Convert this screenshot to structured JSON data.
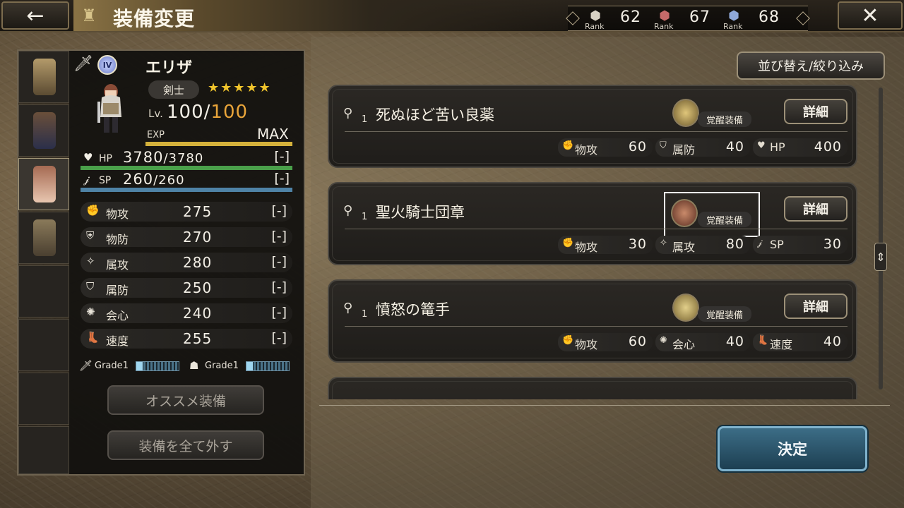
{
  "header": {
    "back_icon": "←",
    "title": "装備変更",
    "close_icon": "✕",
    "ranks": [
      {
        "icon": "rank-weapon-icon",
        "label": "Rank",
        "value": "62"
      },
      {
        "icon": "rank-armor-icon",
        "label": "Rank",
        "value": "67"
      },
      {
        "icon": "rank-accessory-icon",
        "label": "Rank",
        "value": "68"
      }
    ]
  },
  "character": {
    "name": "エリザ",
    "rank_badge": "IV",
    "job": "剣士",
    "stars": "★★★★★",
    "level_label": "Lv.",
    "level": "100",
    "level_sep": "/",
    "level_max": "100",
    "exp_label": "EXP",
    "exp_max": "MAX",
    "hp_label": "HP",
    "hp_value": "3780",
    "hp_max": "/3780",
    "hp_diff": "[-]",
    "sp_label": "SP",
    "sp_value": "260",
    "sp_max": "/260",
    "sp_diff": "[-]",
    "stats": [
      {
        "label": "物攻",
        "value": "275",
        "diff": "[-]"
      },
      {
        "label": "物防",
        "value": "270",
        "diff": "[-]"
      },
      {
        "label": "属攻",
        "value": "280",
        "diff": "[-]"
      },
      {
        "label": "属防",
        "value": "250",
        "diff": "[-]"
      },
      {
        "label": "会心",
        "value": "240",
        "diff": "[-]"
      },
      {
        "label": "速度",
        "value": "255",
        "diff": "[-]"
      }
    ],
    "grades": [
      {
        "label": "Grade1",
        "fill": 0.15
      },
      {
        "label": "Grade1",
        "fill": 0.15
      }
    ]
  },
  "buttons": {
    "recommend": "オススメ装備",
    "unequip_all": "装備を全て外す",
    "sort_filter": "並び替え/絞り込み",
    "confirm": "決定"
  },
  "items": [
    {
      "count": "1",
      "name": "死ぬほど苦い良薬",
      "awaken_tag": "覚醒装備",
      "detail": "詳細",
      "stats": [
        {
          "label": "物攻",
          "value": "60"
        },
        {
          "label": "属防",
          "value": "40"
        },
        {
          "label": "HP",
          "value": "400"
        }
      ]
    },
    {
      "count": "1",
      "name": "聖火騎士団章",
      "awaken_tag": "覚醒装備",
      "detail": "詳細",
      "stats": [
        {
          "label": "物攻",
          "value": "30"
        },
        {
          "label": "属攻",
          "value": "80"
        },
        {
          "label": "SP",
          "value": "30"
        }
      ]
    },
    {
      "count": "1",
      "name": "憤怒の篭手",
      "awaken_tag": "覚醒装備",
      "detail": "詳細",
      "stats": [
        {
          "label": "物攻",
          "value": "60"
        },
        {
          "label": "会心",
          "value": "40"
        },
        {
          "label": "速度",
          "value": "40"
        }
      ]
    }
  ]
}
